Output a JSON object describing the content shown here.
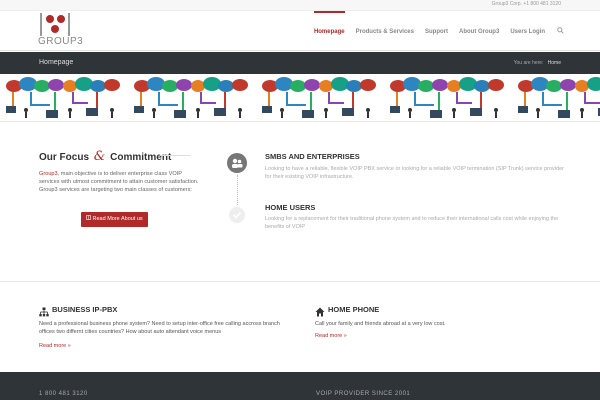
{
  "topbar": {
    "contact": "Group3 Corp. +1 800 481 3120"
  },
  "logo": {
    "word": "GROUP3"
  },
  "nav": {
    "items": [
      "Homepage",
      "Products & Services",
      "Support",
      "About Group3",
      "Users Login"
    ],
    "active_index": 0
  },
  "titlebar": {
    "title": "Homepage",
    "crumb_prefix": "You are here:",
    "crumb_current": "Home"
  },
  "focus": {
    "title_left": "Our Focus",
    "title_amp": "&",
    "title_right": "Commitment",
    "text_brand": "Group3",
    "text_rest": ", main objective is to deliver enterprise class VOIP services with utmost commitment to attain customer satisfaction. Group3 services are targeting two main classes of customers:",
    "button": "Read More About us"
  },
  "services": [
    {
      "title": "SMBS AND ENTERPRISES",
      "text": "Looking to have a reliable, flexible VOIP PBX service or looking for a reliable VOIP termination (SIP Trunk) service provider for their existing VOIP infrastructure."
    },
    {
      "title": "HOME USERS",
      "text": "Looking for a replacement for their traditional phone system and  to reduce their international calls cost while enjoying the benefits of VOIP"
    }
  ],
  "lower": [
    {
      "title": "BUSINESS IP-PBX",
      "icon": "sitemap-icon",
      "text": "Need a professional business phone system? Need to setup inter-office free calling accross branch offices two differnt cities countries? How about auto attendant voice menus",
      "more": "Read more »"
    },
    {
      "title": "HOME PHONE",
      "icon": "home-icon",
      "text": "Call your family and friends abroad at a very low cost.",
      "more": "Read more »"
    }
  ],
  "footer": {
    "phone": "1 800 481 3120",
    "since": "VOIP PROVIDER SINCE 2001"
  },
  "colors": {
    "accent": "#b02a2a",
    "dark": "#2e3438"
  }
}
